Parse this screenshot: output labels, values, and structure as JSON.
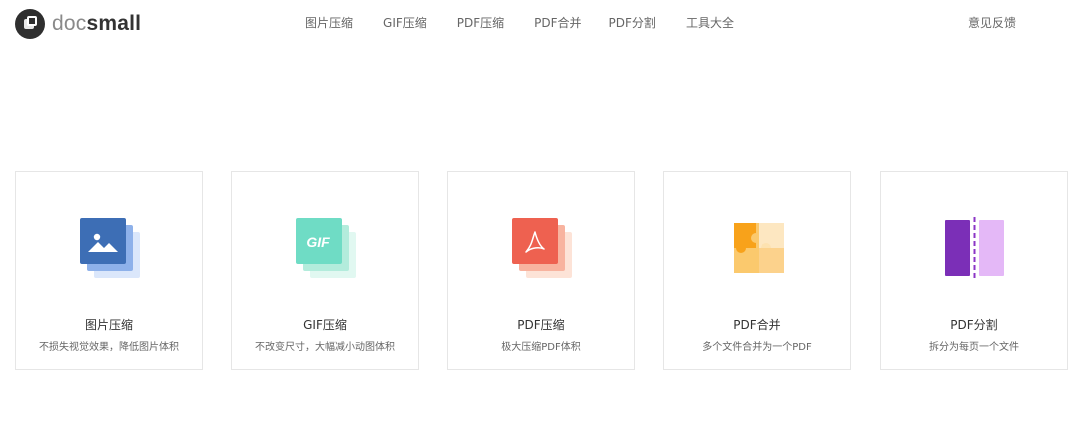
{
  "logo": {
    "doc": "doc",
    "small": "small"
  },
  "nav": {
    "items": [
      {
        "label": "图片压缩"
      },
      {
        "label": "GIF压缩"
      },
      {
        "label": "PDF压缩"
      },
      {
        "label": "PDF合并"
      },
      {
        "label": "PDF分割"
      },
      {
        "label": "工具大全"
      }
    ],
    "feedback": "意见反馈"
  },
  "cards": [
    {
      "title": "图片压缩",
      "desc": "不损失视觉效果，降低图片体积",
      "icon": "image-icon",
      "color": "#3d6eb5"
    },
    {
      "title": "GIF压缩",
      "desc": "不改变尺寸，大幅减小动图体积",
      "icon": "gif-icon",
      "color": "#6fdcc5",
      "icon_text": "GIF"
    },
    {
      "title": "PDF压缩",
      "desc": "极大压缩PDF体积",
      "icon": "pdf-icon",
      "color": "#ee6150"
    },
    {
      "title": "PDF合并",
      "desc": "多个文件合并为一个PDF",
      "icon": "puzzle-icon",
      "color": "#f9a825"
    },
    {
      "title": "PDF分割",
      "desc": "拆分为每页一个文件",
      "icon": "split-icon",
      "color": "#7b2fb7"
    }
  ]
}
